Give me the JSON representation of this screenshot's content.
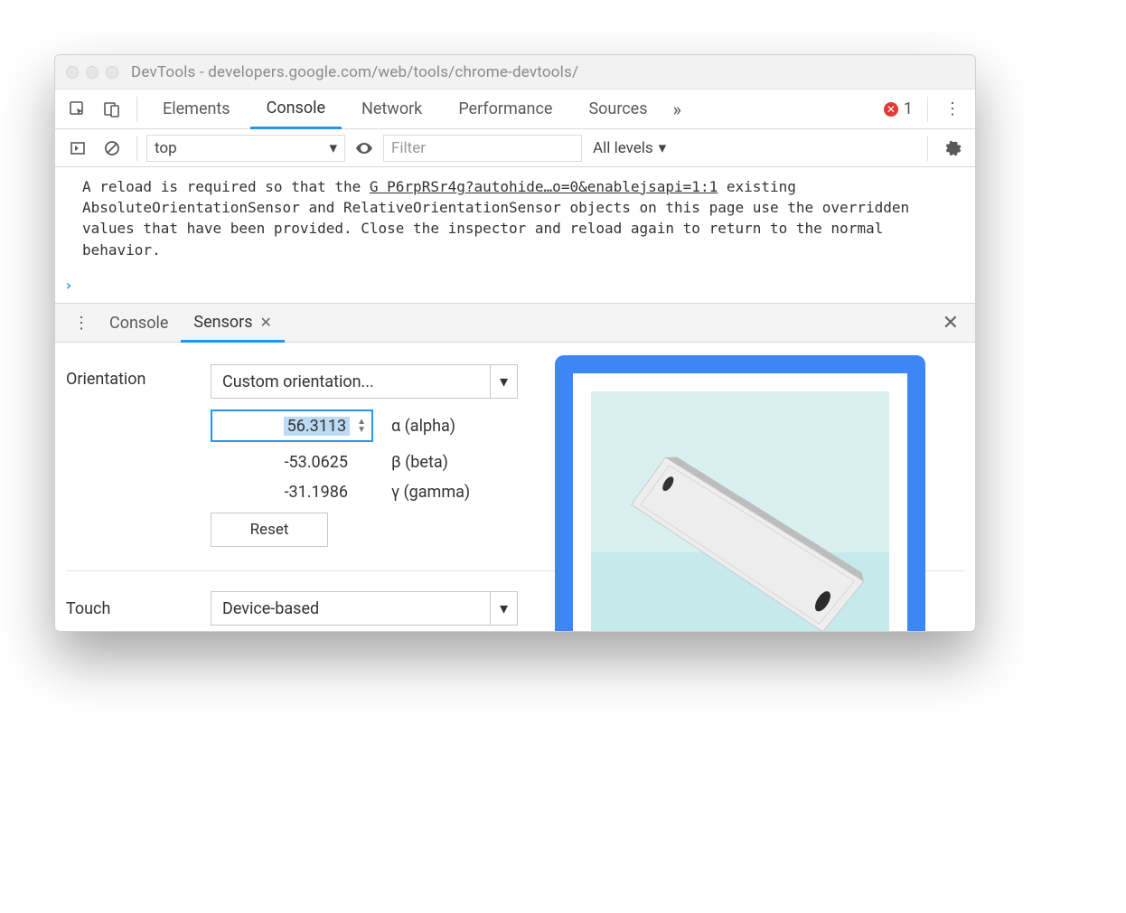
{
  "window": {
    "title": "DevTools - developers.google.com/web/tools/chrome-devtools/"
  },
  "mainTabs": {
    "items": [
      "Elements",
      "Console",
      "Network",
      "Performance",
      "Sources"
    ],
    "activeIndex": 1,
    "overflowGlyph": "»",
    "errorCount": "1"
  },
  "consoleToolbar": {
    "contextLabel": "top",
    "filterPlaceholder": "Filter",
    "levelsLabel": "All levels"
  },
  "consoleMessage": {
    "linePrefix": "A reload is required so that the ",
    "linkText": "G P6rpRSr4g?autohide…o=0&enablejsapi=1:1",
    "rest": "existing AbsoluteOrientationSensor and RelativeOrientationSensor objects on this page use the overridden values that have been provided. Close the inspector and reload again to return to the normal behavior.",
    "promptGlyph": "›"
  },
  "drawerTabs": {
    "items": [
      "Console",
      "Sensors"
    ],
    "activeIndex": 1
  },
  "sensors": {
    "orientation": {
      "label": "Orientation",
      "selectValue": "Custom orientation...",
      "alpha": {
        "value": "56.3113",
        "label": "α (alpha)"
      },
      "beta": {
        "value": "-53.0625",
        "label": "β (beta)"
      },
      "gamma": {
        "value": "-31.1986",
        "label": "γ (gamma)"
      },
      "resetLabel": "Reset"
    },
    "touch": {
      "label": "Touch",
      "selectValue": "Device-based"
    }
  }
}
